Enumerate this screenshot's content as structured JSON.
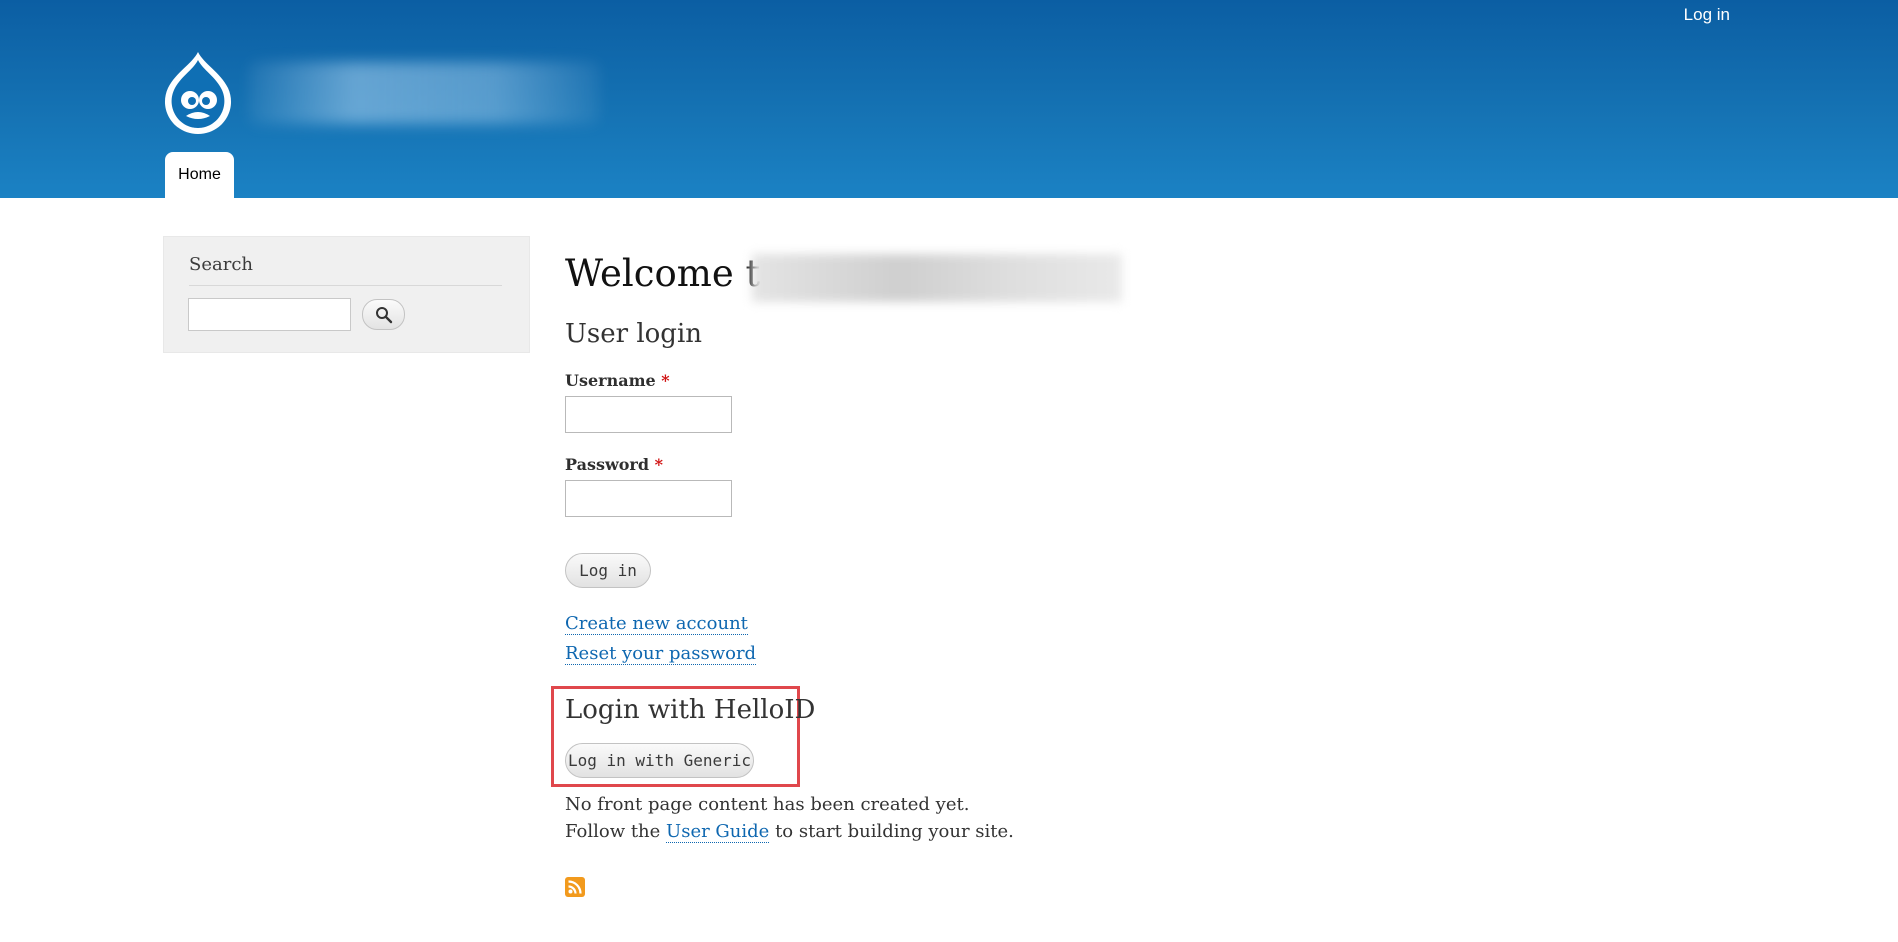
{
  "header": {
    "login_link": "Log in",
    "nav": {
      "home_tab": "Home"
    }
  },
  "sidebar": {
    "search": {
      "title": "Search",
      "input_value": "",
      "button_icon": "search-icon"
    }
  },
  "main": {
    "welcome_prefix": "Welcome to",
    "login_form": {
      "title": "User login",
      "username_label": "Username",
      "password_label": "Password",
      "required_marker": "*",
      "username_value": "",
      "password_value": "",
      "submit_label": "Log in"
    },
    "links": {
      "create_account": "Create new account",
      "reset_password": "Reset your password"
    },
    "helloid": {
      "title": "Login with HelloID",
      "button_label": "Log in with Generic"
    },
    "front_page": {
      "line1": "No front page content has been created yet.",
      "line2_prefix": "Follow the",
      "user_guide_link": "User Guide",
      "line2_suffix": "to start building your site."
    },
    "feed_icon": "rss-feed-icon"
  },
  "colors": {
    "header_top": "#0b5ea3",
    "header_bottom": "#1b82c4",
    "link": "#0e67b0",
    "required": "#d01111",
    "highlight": "#e0474c"
  }
}
